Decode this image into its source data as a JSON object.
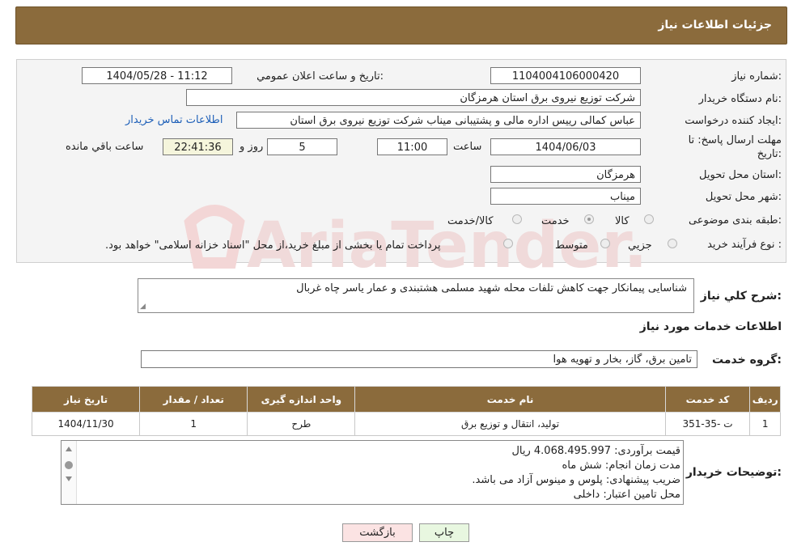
{
  "header": {
    "title": "جزئیات اطلاعات نیاز"
  },
  "form": {
    "need_number_label": "شماره نیاز:",
    "need_number": "1104004106000420",
    "announce_label": "تاريخ و ساعت اعلان عمومي:",
    "announce_value": "1404/05/28 - 11:12",
    "buyer_label": "نام دستگاه خريدار:",
    "buyer_value": "شرکت توزیع نیروی برق استان هرمزگان",
    "creator_label": "ايجاد کننده درخواست:",
    "creator_value": "عباس کمالی رییس اداره مالی و پشتیبانی میناب شرکت توزیع نیروی برق استان",
    "contact_link": "اطلاعات تماس خريدار",
    "deadline_label_1": "مهلت ارسال پاسخ: تا",
    "deadline_label_2": "تاريخ:",
    "deadline_date": "1404/06/03",
    "time_label": "ساعت",
    "deadline_time": "11:00",
    "days_value": "5",
    "days_label": "روز و",
    "remaining_time": "22:41:36",
    "remaining_label": "ساعت باقي مانده",
    "province_label": "استان محل تحويل:",
    "province_value": "هرمزگان",
    "city_label": "شهر محل تحويل:",
    "city_value": "میناب",
    "category_label": "طبقه بندی موضوعی:",
    "category_options": [
      "کالا",
      "خدمت",
      "کالا/خدمت"
    ],
    "category_selected": "خدمت",
    "purchase_type_label": "نوع فرآيند خريد :",
    "purchase_options": [
      "جزیي",
      "متوسط"
    ],
    "purchase_note": "پرداخت تمام یا بخشی از مبلغ خرید،از محل \"اسناد خزانه اسلامی\" خواهد بود."
  },
  "summary": {
    "label": "شرح کلي نياز:",
    "value": "شناسایی پیمانکار جهت کاهش تلفات محله شهید مسلمی هشتبندی و عمار یاسر چاه غربال"
  },
  "services_section": {
    "title": "اطلاعات خدمات مورد نياز",
    "group_label": "گروه خدمت:",
    "group_value": "تامین برق، گاز، بخار و تهویه هوا"
  },
  "table": {
    "headers": [
      "رديف",
      "کد خدمت",
      "نام خدمت",
      "واحد اندازه گيری",
      "تعداد / مقدار",
      "تاريخ نياز"
    ],
    "rows": [
      [
        "1",
        "ت -35-351",
        "تولید، انتقال و توزیع برق",
        "طرح",
        "1",
        "1404/11/30"
      ]
    ]
  },
  "buyer_notes": {
    "label": "توضيحات خريدار:",
    "lines": [
      "قیمت برآوردی:  4.068.495.997 ریال",
      "مدت زمان انجام: شش ماه",
      "ضریب پیشنهادی: پلوس و مینوس آزاد می باشد.",
      "محل تامین اعتبار: داخلی"
    ]
  },
  "buttons": {
    "print": "چاپ",
    "back": "بازگشت"
  },
  "watermark": "AriaTender.net",
  "colors": {
    "header_bg": "#8b6b3c",
    "link": "#1d5fb8",
    "print_btn": "#e8f7e0",
    "back_btn": "#fbe3e3"
  }
}
